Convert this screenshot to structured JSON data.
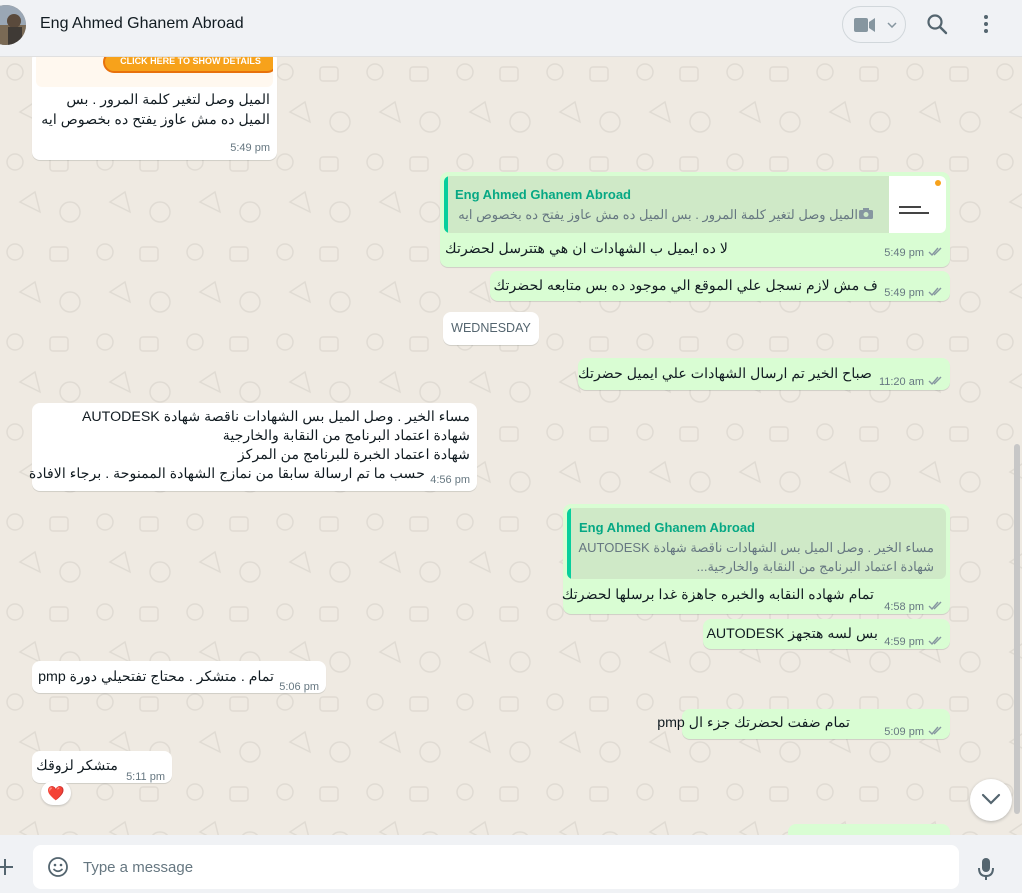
{
  "header": {
    "contact_name": "Eng Ahmed Ghanem Abroad"
  },
  "messages": {
    "m1": {
      "button_label": "CLICK HERE TO SHOW DETAILS",
      "line1": "الميل وصل لتغير كلمة المرور . بس",
      "line2": "الميل ده مش عاوز يفتح ده بخصوص ايه",
      "time": "5:49 pm"
    },
    "m2": {
      "quote_name": "Eng Ahmed Ghanem Abroad",
      "quote_text": "الميل وصل لتغير كلمة المرور . بس الميل ده مش عاوز يفتح ده بخصوص ايه",
      "text": "لا ده ايميل ب الشهادات ان هي هتترسل لحضرتك",
      "time": "5:49 pm"
    },
    "m3": {
      "text": "ف مش لازم نسجل علي الموقع الي موجود ده بس متابعه لحضرتك",
      "time": "5:49 pm"
    },
    "date_separator": "WEDNESDAY",
    "m4": {
      "text": "صباح الخير تم ارسال الشهادات علي ايميل حضرتك",
      "time": "11:20 am"
    },
    "m5": {
      "line1": "مساء الخير . وصل الميل بس الشهادات ناقصة شهادة AUTODESK",
      "line2": "شهادة اعتماد البرنامج من النقابة والخارجية",
      "line3": "شهادة اعتماد الخبرة للبرنامج من المركز",
      "line4": "حسب ما تم ارسالة سابقا من نمازج الشهادة الممنوحة . برجاء الافادة",
      "time": "4:56 pm"
    },
    "m6": {
      "quote_name": "Eng Ahmed Ghanem Abroad",
      "quote_line1": "مساء الخير . وصل الميل بس الشهادات ناقصة شهادة AUTODESK",
      "quote_line2": "شهادة اعتماد البرنامج من النقابة والخارجية...",
      "text": "تمام شهاده النقابه والخبره جاهزة غدا برسلها لحضرتك",
      "time": "4:58 pm"
    },
    "m7": {
      "text": "بس لسه هتجهز AUTODESK",
      "time": "4:59 pm"
    },
    "m8": {
      "text": "تمام . متشكر . محتاج تفتحيلي دورة pmp",
      "time": "5:06 pm"
    },
    "m9": {
      "text": "تمام ضفت لحضرتك جزء ال pmp",
      "time": "5:09 pm"
    },
    "m10": {
      "text": "متشكر لزوقك",
      "time": "5:11 pm",
      "reaction": "❤️"
    }
  },
  "composer": {
    "placeholder": "Type a message"
  },
  "colors": {
    "incoming_bubble": "#ffffff",
    "outgoing_bubble": "#d9fdd3",
    "accent": "#06a884",
    "chat_background": "#efeae2"
  },
  "icons": [
    "video-call-icon",
    "search-icon",
    "menu-icon",
    "emoji-icon",
    "plus-icon",
    "mic-icon",
    "double-check-icon",
    "chevron-down-icon"
  ]
}
